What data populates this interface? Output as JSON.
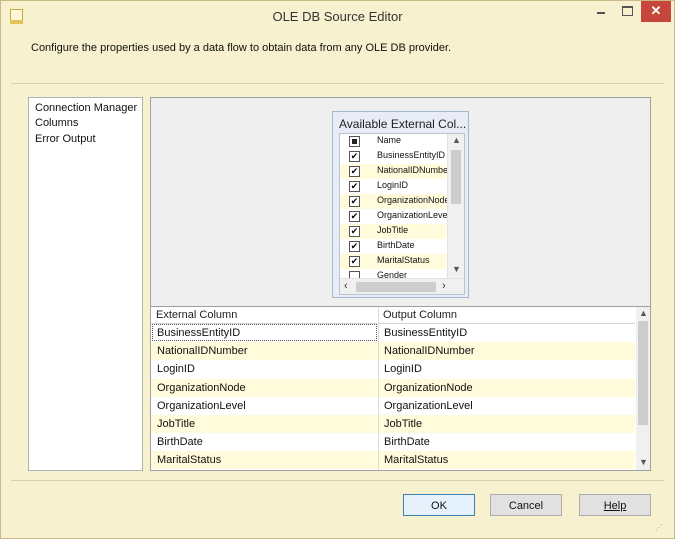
{
  "window": {
    "title": "OLE DB Source Editor",
    "close_glyph": "✕"
  },
  "description": "Configure the properties used by a data flow to obtain data from any OLE DB provider.",
  "nav": {
    "items": [
      {
        "label": "Connection Manager"
      },
      {
        "label": "Columns"
      },
      {
        "label": "Error Output"
      }
    ]
  },
  "available": {
    "title": "Available External Col...",
    "header": "Name",
    "columns": [
      {
        "name": "BusinessEntityID",
        "checked": true
      },
      {
        "name": "NationalIDNumber",
        "checked": true
      },
      {
        "name": "LoginID",
        "checked": true
      },
      {
        "name": "OrganizationNode",
        "checked": true
      },
      {
        "name": "OrganizationLevel",
        "checked": true
      },
      {
        "name": "JobTitle",
        "checked": true
      },
      {
        "name": "BirthDate",
        "checked": true
      },
      {
        "name": "MaritalStatus",
        "checked": true
      },
      {
        "name": "Gender",
        "checked": false
      }
    ]
  },
  "mapping": {
    "headers": [
      "External Column",
      "Output Column"
    ],
    "rows": [
      [
        "BusinessEntityID",
        "BusinessEntityID"
      ],
      [
        "NationalIDNumber",
        "NationalIDNumber"
      ],
      [
        "LoginID",
        "LoginID"
      ],
      [
        "OrganizationNode",
        "OrganizationNode"
      ],
      [
        "OrganizationLevel",
        "OrganizationLevel"
      ],
      [
        "JobTitle",
        "JobTitle"
      ],
      [
        "BirthDate",
        "BirthDate"
      ],
      [
        "MaritalStatus",
        "MaritalStatus"
      ]
    ]
  },
  "buttons": {
    "ok": "OK",
    "cancel": "Cancel",
    "help": "Help"
  },
  "colors": {
    "window_bg": "#f7f1cf",
    "close_red": "#c7463b",
    "row_alt": "#fffbdb"
  }
}
